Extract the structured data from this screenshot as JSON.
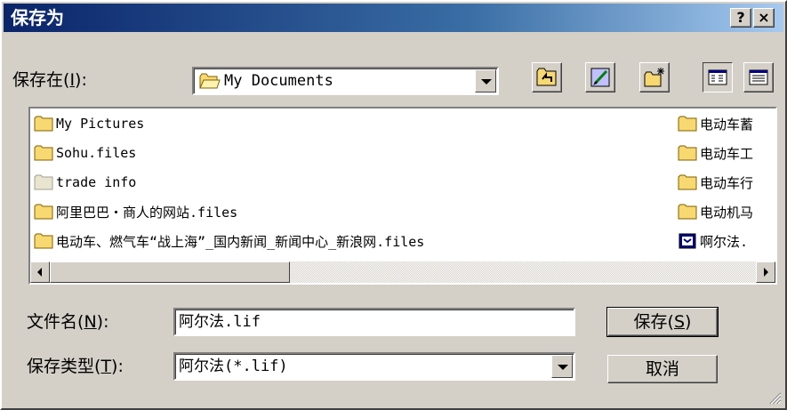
{
  "title": "保存为",
  "title_buttons": {
    "help": "?",
    "close": "×"
  },
  "save_in": {
    "label": "保存在",
    "mnemonic": "I",
    "value": "My Documents"
  },
  "toolbar": [
    "up-one-level-icon",
    "desktop-icon",
    "new-folder-icon",
    "list-view-icon",
    "details-view-icon"
  ],
  "files_left": [
    "My Pictures",
    "Sohu.files",
    "trade info",
    "阿里巴巴・商人的网站.files",
    "电动车、燃气车“战上海”_国内新闻_新闻中心_新浪网.files"
  ],
  "files_right": [
    "电动车蓄",
    "电动车工",
    "电动车行",
    "电动机马",
    "啊尔法."
  ],
  "file_name": {
    "label": "文件名",
    "mnemonic": "N",
    "value": "阿尔法.lif"
  },
  "save_type": {
    "label": "保存类型",
    "mnemonic": "T",
    "value": "阿尔法(*.lif)"
  },
  "buttons": {
    "save": "保存",
    "save_mnemonic": "S",
    "cancel": "取消"
  },
  "colors": {
    "title_start": "#0a246a",
    "title_end": "#a6caf0",
    "face": "#d4d0c8",
    "folder": "#f7d871"
  }
}
